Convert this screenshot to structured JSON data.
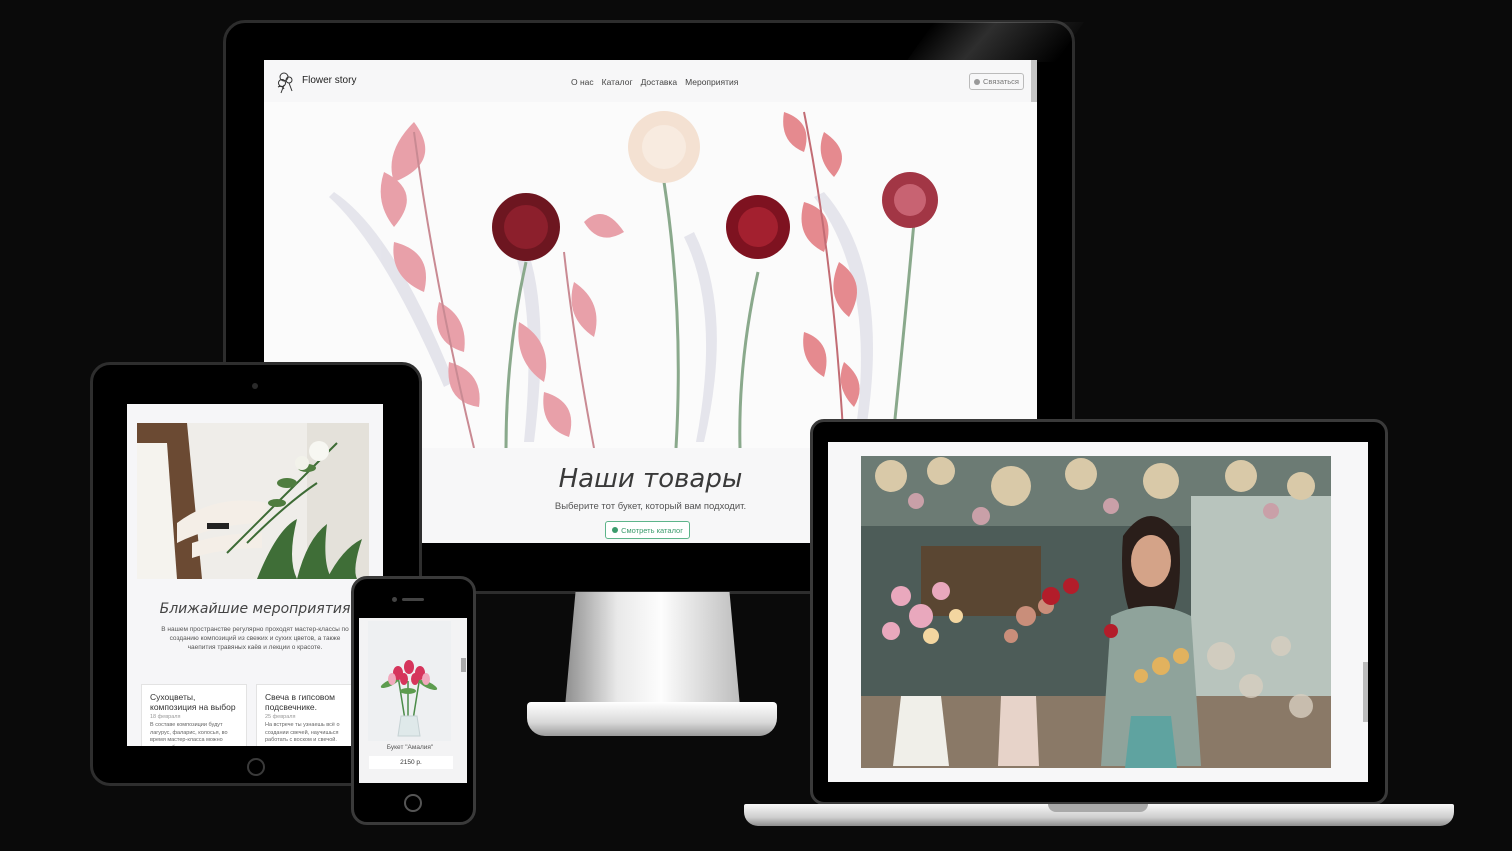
{
  "desktop": {
    "brand": "Flower story",
    "nav_links": [
      "О нас",
      "Каталог",
      "Доставка",
      "Мероприятия"
    ],
    "contact_button": "Связаться",
    "section_title": "Наши товары",
    "section_subtitle": "Выберите тот букет, который вам подходит.",
    "catalog_button": "Смотреть каталог",
    "colors": {
      "accent": "#3b9b6c",
      "nav_bg": "#f7f7f8"
    }
  },
  "tablet": {
    "section_title": "Ближайшие мероприятия",
    "section_text": "В нашем пространстве регулярно проходят мастер-классы по созданию композиций из свежих и сухих цветов, а также чаепития травяных каёв и лекции о красоте.",
    "events": [
      {
        "title": "Сухоцветы, композиция на выбор",
        "date": "18 февраля",
        "text": "В составе композиции будут лагурус, фаларис, колосья, во время мастер-класса можно сделать букет."
      },
      {
        "title": "Свеча в гипсовом подсвечнике.",
        "date": "25 февраля",
        "text": "На встрече ты узнаешь всё о создании свечей, научишься работать с воском и свечой."
      }
    ]
  },
  "phone": {
    "product_name": "Букет \"Амалия\"",
    "product_price": "2150 р."
  },
  "laptop": {}
}
